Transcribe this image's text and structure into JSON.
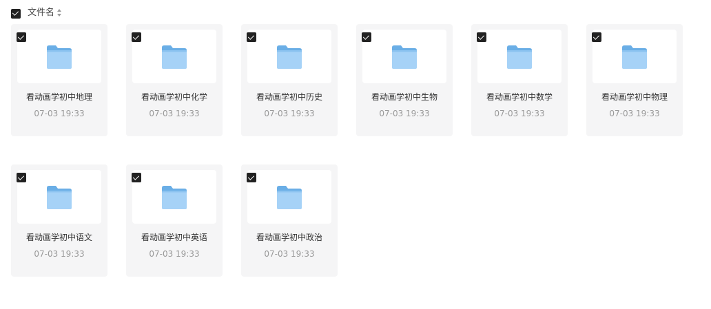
{
  "header": {
    "select_all_checked": true,
    "column_label": "文件名",
    "sort_icon": "sort-icon"
  },
  "colors": {
    "checkbox": "#222222",
    "card_background": "#f5f5f6",
    "folder_light": "#a6d2f7",
    "folder_dark": "#6aaee6",
    "name_text": "#333333",
    "time_text": "#999999"
  },
  "folders": [
    {
      "name": "看动画学初中地理",
      "time": "07-03 19:33",
      "checked": true,
      "icon": "folder-icon"
    },
    {
      "name": "看动画学初中化学",
      "time": "07-03 19:33",
      "checked": true,
      "icon": "folder-icon"
    },
    {
      "name": "看动画学初中历史",
      "time": "07-03 19:33",
      "checked": true,
      "icon": "folder-icon"
    },
    {
      "name": "看动画学初中生物",
      "time": "07-03 19:33",
      "checked": true,
      "icon": "folder-icon"
    },
    {
      "name": "看动画学初中数学",
      "time": "07-03 19:33",
      "checked": true,
      "icon": "folder-icon"
    },
    {
      "name": "看动画学初中物理",
      "time": "07-03 19:33",
      "checked": true,
      "icon": "folder-icon"
    },
    {
      "name": "看动画学初中语文",
      "time": "07-03 19:33",
      "checked": true,
      "icon": "folder-icon"
    },
    {
      "name": "看动画学初中英语",
      "time": "07-03 19:33",
      "checked": true,
      "icon": "folder-icon"
    },
    {
      "name": "看动画学初中政治",
      "time": "07-03 19:33",
      "checked": true,
      "icon": "folder-icon"
    }
  ]
}
